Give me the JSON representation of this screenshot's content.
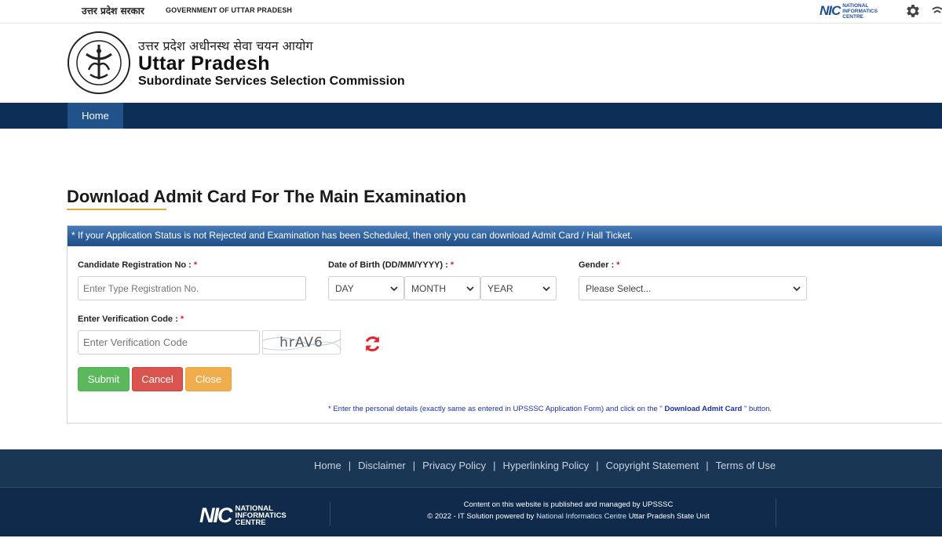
{
  "gov_bar": {
    "hindi": "उत्तर प्रदेश सरकार",
    "english": "GOVERNMENT OF UTTAR PRADESH",
    "nic_mark": "NIC",
    "nic_words": [
      "NATIONAL",
      "INFORMATICS",
      "CENTRE"
    ]
  },
  "header": {
    "hindi_name": "उत्तर प्रदेश अधीनस्थ सेवा चयन आयोग",
    "name": "Uttar Pradesh",
    "subtitle": "Subordinate Services Selection Commission",
    "emblem_text": "उत्तर प्रदेश सरकार"
  },
  "nav": {
    "items": [
      {
        "label": "Home",
        "active": true
      }
    ]
  },
  "main": {
    "title": "Download Admit Card For The Main Examination",
    "notice": "* If your Application Status is not Rejected and Examination has been Scheduled, then only you can download Admit Card / Hall Ticket.",
    "form": {
      "registration": {
        "label": "Candidate Registration No :",
        "required_mark": "*",
        "placeholder": "Enter Type Registration No."
      },
      "dob": {
        "label": "Date of Birth (DD/MM/YYYY) :",
        "required_mark": "*",
        "day": "DAY",
        "month": "MONTH",
        "year": "YEAR"
      },
      "gender": {
        "label": "Gender :",
        "required_mark": "*",
        "selected": "Please Select..."
      },
      "verification": {
        "label": "Enter Verification Code :",
        "required_mark": "*",
        "placeholder": "Enter Verification Code",
        "captcha": "hrAV6"
      },
      "buttons": {
        "submit": "Submit",
        "cancel": "Cancel",
        "close": "Close"
      }
    },
    "note_prefix": "* Enter the personal details (exactly same as entered in UPSSSC Application Form) and click on the \"",
    "note_bold": " Download Admit Card ",
    "note_suffix": "\" button."
  },
  "footer": {
    "links": [
      "Home",
      "Disclaimer",
      "Privacy Policy",
      "Hyperlinking Policy",
      "Copyright Statement",
      "Terms of Use"
    ],
    "separator": "|",
    "line1": "Content on this website is published and managed by UPSSSC",
    "line2_prefix": "© 2022 - IT Solution powered by ",
    "line2_highlight": "National Informatics Centre",
    "line2_suffix": " Uttar Pradesh State Unit",
    "nic_mark": "NIC",
    "nic_words": [
      "NATIONAL",
      "INFORMATICS",
      "CENTRE"
    ]
  },
  "colors": {
    "nav_bg": "#0d2f57",
    "nav_active": "#22528a",
    "accent_underline": "#e2a93b",
    "submit": "#5cb85c",
    "cancel": "#d9534f",
    "close": "#f0ad4e",
    "required": "#d9232d",
    "note": "#1a2fb0"
  }
}
